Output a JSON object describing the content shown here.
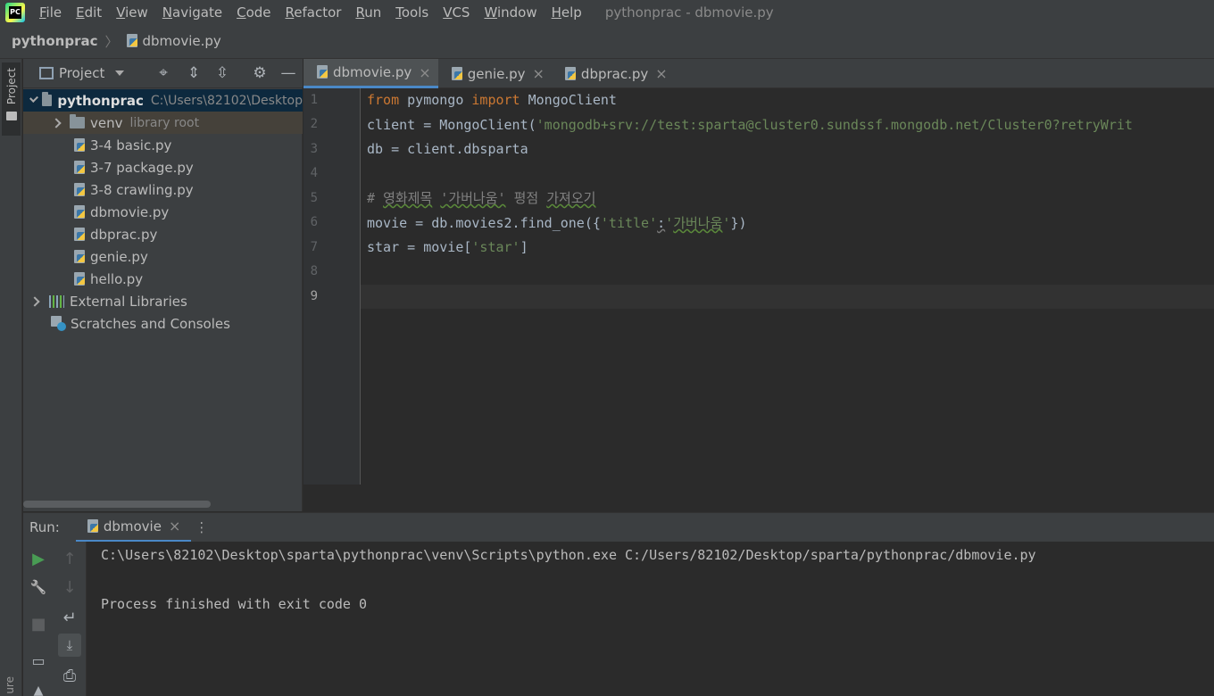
{
  "menubar": {
    "items": [
      "File",
      "Edit",
      "View",
      "Navigate",
      "Code",
      "Refactor",
      "Run",
      "Tools",
      "VCS",
      "Window",
      "Help"
    ],
    "window_title": "pythonprac - dbmovie.py"
  },
  "navbar": {
    "project": "pythonprac",
    "file": "dbmovie.py"
  },
  "left_stripe": {
    "project_label": "Project",
    "structure_label": "ure"
  },
  "project_panel": {
    "title": "Project",
    "tree": [
      {
        "label": "pythonprac",
        "extra": "C:\\Users\\82102\\Desktop"
      },
      {
        "label": "venv",
        "extra": "library root"
      },
      {
        "label": "3-4 basic.py"
      },
      {
        "label": "3-7 package.py"
      },
      {
        "label": "3-8 crawling.py"
      },
      {
        "label": "dbmovie.py"
      },
      {
        "label": "dbprac.py"
      },
      {
        "label": "genie.py"
      },
      {
        "label": "hello.py"
      },
      {
        "label": "External Libraries"
      },
      {
        "label": "Scratches and Consoles"
      }
    ]
  },
  "editor": {
    "tabs": [
      {
        "label": "dbmovie.py",
        "active": true
      },
      {
        "label": "genie.py"
      },
      {
        "label": "dbprac.py"
      }
    ],
    "line_numbers": [
      "1",
      "2",
      "3",
      "4",
      "5",
      "6",
      "7",
      "8",
      "9"
    ],
    "code": {
      "l1_from": "from",
      "l1_mod": " pymongo ",
      "l1_import": "import",
      "l1_name": " MongoClient",
      "l2_pre": "client = MongoClient(",
      "l2_str": "'mongodb+srv://test:sparta@cluster0.sundssf.mongodb.net/Cluster0?retryWrit",
      "l3": "db = client.dbsparta",
      "l5_hash": "# ",
      "l5_w1": "영화제목",
      "l5_sp1": " ",
      "l5_w2": "'가버나움'",
      "l5_sp2": " 평점 ",
      "l5_w3": "가져오기",
      "l6_pre": "movie = db.movies2.find_one({",
      "l6_key": "'title'",
      "l6_colon": ":",
      "l6_val_q1": "'",
      "l6_val": "가버나움",
      "l6_val_q2": "'",
      "l6_post": "})",
      "l7_pre": "star = movie[",
      "l7_str": "'star'",
      "l7_post": "]"
    }
  },
  "run_panel": {
    "label": "Run:",
    "tab": "dbmovie",
    "console": [
      "C:\\Users\\82102\\Desktop\\sparta\\pythonprac\\venv\\Scripts\\python.exe C:/Users/82102/Desktop/sparta/pythonprac/dbmovie.py",
      "",
      "Process finished with exit code 0"
    ]
  },
  "icons": {
    "close": "×",
    "locate": "⌖",
    "expand": "⇕",
    "collapse": "⇳",
    "settings": "⚙",
    "hide": "—",
    "run": "▶",
    "wrench": "🔧",
    "stop": "■",
    "up": "↑",
    "down": "↓",
    "wrap": "↵",
    "print": "⎙"
  },
  "colors": {
    "accent": "#4a88c7",
    "run_green": "#499c54"
  }
}
